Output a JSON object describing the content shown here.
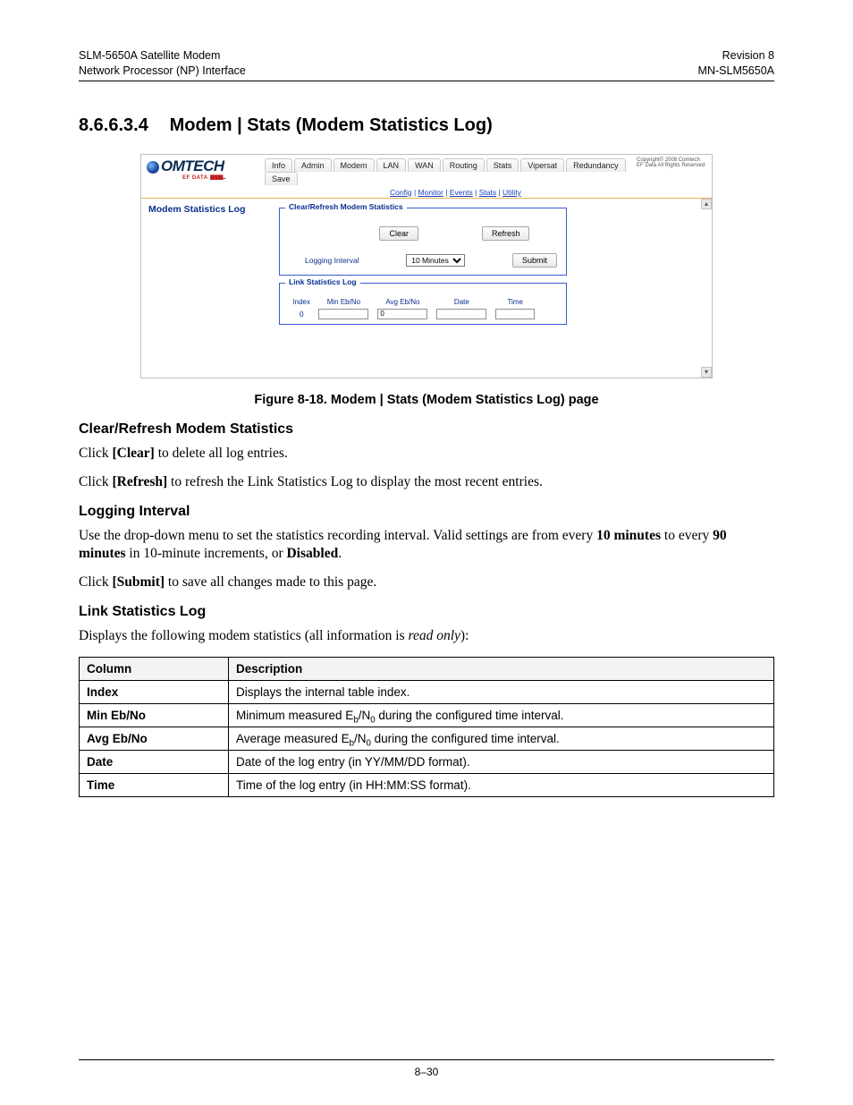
{
  "header": {
    "left1": "SLM-5650A Satellite Modem",
    "left2": "Network Processor (NP) Interface",
    "right1": "Revision 8",
    "right2": "MN-SLM5650A"
  },
  "section": {
    "number": "8.6.6.3.4",
    "title": "Modem | Stats (Modem Statistics Log)"
  },
  "screenshot": {
    "logo": {
      "text": "OMTECH",
      "sub": "EF DATA",
      "bars": "▮▮▮▮▮..."
    },
    "tabs": [
      "Info",
      "Admin",
      "Modem",
      "LAN",
      "WAN",
      "Routing",
      "Stats",
      "Vipersat",
      "Redundancy",
      "Save"
    ],
    "subnav": [
      "Config",
      "Monitor",
      "Events",
      "Stats",
      "Utility"
    ],
    "copyright": "Copyright© 2008 Comtech EF Data All Rights Reserved",
    "sidebar_title": "Modem Statistics Log",
    "fs1": {
      "legend": "Clear/Refresh Modem Statistics",
      "clear": "Clear",
      "refresh": "Refresh",
      "label": "Logging Interval",
      "select": "10 Minutes",
      "submit": "Submit"
    },
    "fs2": {
      "legend": "Link Statistics Log",
      "headers": [
        "Index",
        "Min Eb/No",
        "Avg Eb/No",
        "Date",
        "Time"
      ],
      "row": {
        "index": "0",
        "min": "",
        "avg": "0",
        "date": "",
        "time": ""
      }
    }
  },
  "figcaption": "Figure 8-18. Modem | Stats (Modem Statistics Log) page",
  "sub1": {
    "title": "Clear/Refresh Modem Statistics",
    "p1a": "Click ",
    "p1b": "[Clear]",
    "p1c": " to delete all log entries.",
    "p2a": "Click ",
    "p2b": "[Refresh]",
    "p2c": " to refresh the Link Statistics Log to display the most recent entries."
  },
  "sub2": {
    "title": "Logging Interval",
    "p1": "Use the drop-down menu to set the statistics recording interval. Valid settings are from every ",
    "p1b": "10 minutes",
    "p1c": " to every ",
    "p1d": "90 minutes",
    "p1e": " in 10-minute increments, or ",
    "p1f": "Disabled",
    "p1g": ".",
    "p2a": "Click ",
    "p2b": "[Submit]",
    "p2c": " to save all changes made to this page."
  },
  "sub3": {
    "title": "Link Statistics Log",
    "p1": "Displays the following modem statistics (all information is ",
    "p1it": "read only",
    "p1end": "):"
  },
  "table": {
    "headers": [
      "Column",
      "Description"
    ],
    "rows": [
      {
        "c1": "Index",
        "c2": "Displays the internal table index."
      },
      {
        "c1": "Min Eb/No",
        "c2": "Minimum measured E",
        "sub1": "b",
        "mid": "/N",
        "sub2": "0",
        "rest": " during the configured time interval."
      },
      {
        "c1": "Avg Eb/No",
        "c2": "Average measured E",
        "sub1": "b",
        "mid": "/N",
        "sub2": "0",
        "rest": " during the configured time interval."
      },
      {
        "c1": "Date",
        "c2": "Date of the log entry (in YY/MM/DD format)."
      },
      {
        "c1": "Time",
        "c2": "Time of the log entry (in HH:MM:SS format)."
      }
    ]
  },
  "footer": "8–30"
}
